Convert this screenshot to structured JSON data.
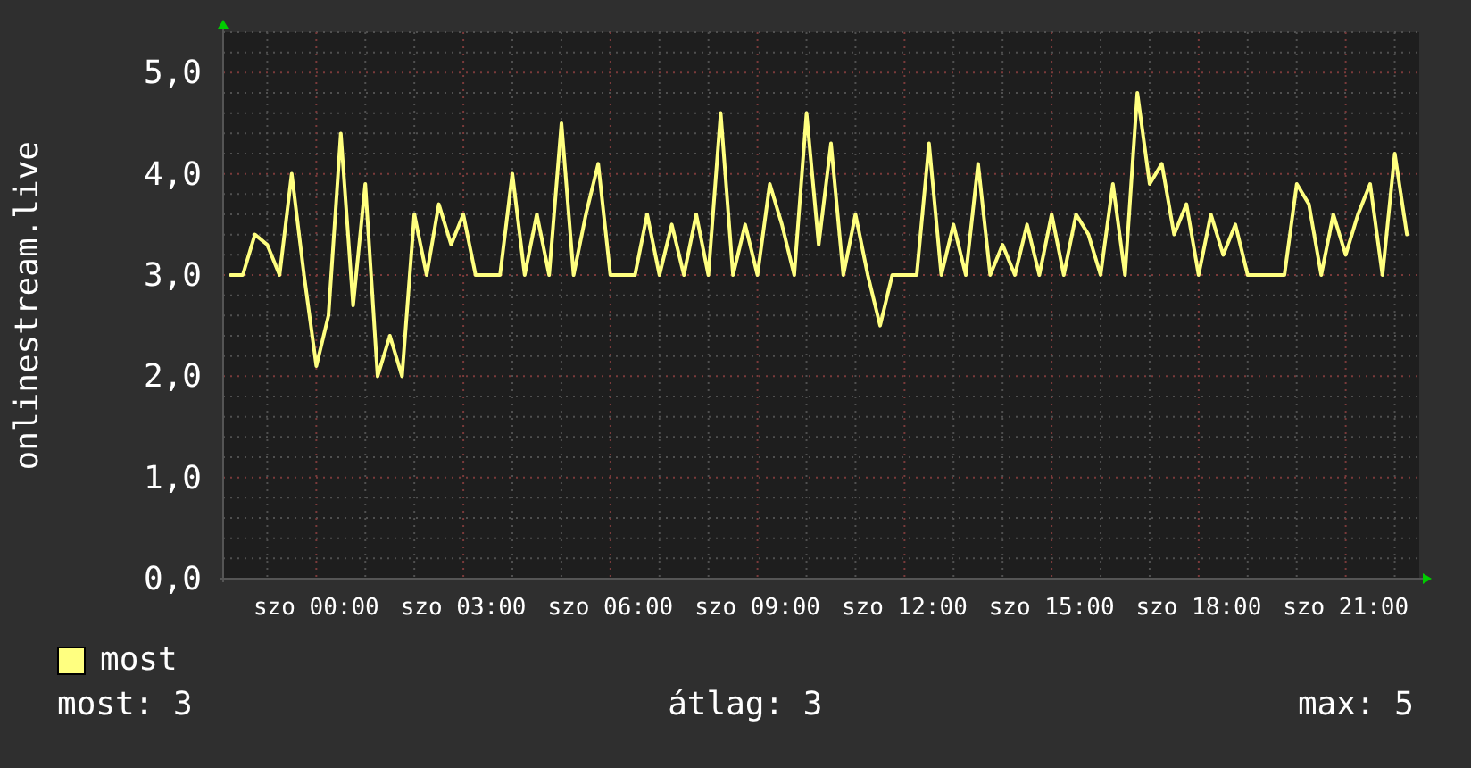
{
  "chart": {
    "chart_data": {
      "type": "line",
      "ylabel": "onlinestream.live",
      "categories": [
        null,
        null,
        null,
        null,
        null,
        null,
        null,
        "szo 00:00",
        null,
        null,
        null,
        null,
        null,
        null,
        null,
        null,
        null,
        null,
        null,
        "szo 03:00",
        null,
        null,
        null,
        null,
        null,
        null,
        null,
        null,
        null,
        null,
        null,
        "szo 06:00",
        null,
        null,
        null,
        null,
        null,
        null,
        null,
        null,
        null,
        null,
        null,
        "szo 09:00",
        null,
        null,
        null,
        null,
        null,
        null,
        null,
        null,
        null,
        null,
        null,
        "szo 12:00",
        null,
        null,
        null,
        null,
        null,
        null,
        null,
        null,
        null,
        null,
        null,
        "szo 15:00",
        null,
        null,
        null,
        null,
        null,
        null,
        null,
        null,
        null,
        null,
        null,
        "szo 18:00",
        null,
        null,
        null,
        null,
        null,
        null,
        null,
        null,
        null,
        null,
        null,
        "szo 21:00",
        null,
        null,
        null,
        null,
        null
      ],
      "series": [
        {
          "name": "most",
          "color": "#ffff80",
          "values": [
            3,
            3,
            3.4,
            3.3,
            3,
            4,
            3,
            2.1,
            2.6,
            4.4,
            2.7,
            3.9,
            2.0,
            2.4,
            2.0,
            3.6,
            3,
            3.7,
            3.3,
            3.6,
            3,
            3,
            3,
            4,
            3,
            3.6,
            3,
            4.5,
            3,
            3.6,
            4.1,
            3,
            3,
            3,
            3.6,
            3,
            3.5,
            3,
            3.6,
            3,
            4.6,
            3,
            3.5,
            3,
            3.9,
            3.5,
            3,
            4.6,
            3.3,
            4.3,
            3,
            3.6,
            3,
            2.5,
            3,
            3,
            3,
            4.3,
            3,
            3.5,
            3,
            4.1,
            3,
            3.3,
            3,
            3.5,
            3,
            3.6,
            3,
            3.6,
            3.4,
            3,
            3.9,
            3,
            4.8,
            3.9,
            4.1,
            3.4,
            3.7,
            3,
            3.6,
            3.2,
            3.5,
            3,
            3,
            3,
            3,
            3.9,
            3.7,
            3,
            3.6,
            3.2,
            3.6,
            3.9,
            3,
            4.2,
            3.4
          ]
        }
      ],
      "grid": true,
      "ylim": [
        0,
        5.4
      ],
      "yticks": [
        {
          "value": 0,
          "label": "0,0"
        },
        {
          "value": 1,
          "label": "1,0"
        },
        {
          "value": 2,
          "label": "2,0"
        },
        {
          "value": 3,
          "label": "3,0"
        },
        {
          "value": 4,
          "label": "4,0"
        },
        {
          "value": 5,
          "label": "5,0"
        }
      ]
    }
  },
  "stats": [
    "most: 3",
    "átlag: 3",
    "max: 5"
  ]
}
